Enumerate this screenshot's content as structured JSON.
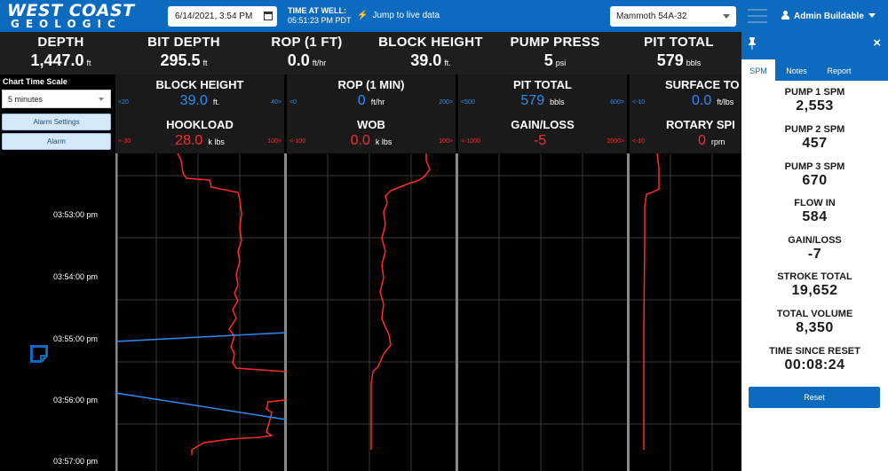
{
  "header": {
    "logo_line1": "WEST COAST",
    "logo_line2": "GEOLOGIC",
    "datetime_value": "6/14/2021, 3:54 PM",
    "time_at_well_label": "TIME AT WELL:",
    "time_at_well_value": "05:51:23 PM PDT",
    "jump_label": "Jump to live data",
    "well_selected": "Mammoth 54A-32",
    "user_label": "Admin Buildable"
  },
  "metrics": [
    {
      "label": "DEPTH",
      "value": "1,447.0",
      "unit": "ft"
    },
    {
      "label": "BIT DEPTH",
      "value": "295.5",
      "unit": "ft"
    },
    {
      "label": "ROP (1 FT)",
      "value": "0.0",
      "unit": "ft/hr"
    },
    {
      "label": "BLOCK HEIGHT",
      "value": "39.0",
      "unit": "ft."
    },
    {
      "label": "PUMP PRESS",
      "value": "5",
      "unit": "psi"
    },
    {
      "label": "PIT TOTAL",
      "value": "579",
      "unit": "bbls"
    }
  ],
  "left": {
    "time_scale_label": "Chart Time Scale",
    "time_scale_value": "5 minutes",
    "alarm_settings_label": "Alarm Settings",
    "alarm_label": "Alarm",
    "times": [
      "03:53:00 pm",
      "03:54:00 pm",
      "03:55:00 pm",
      "03:56:00 pm",
      "03:57:00 pm"
    ]
  },
  "tracks": [
    {
      "top": {
        "label": "BLOCK HEIGHT",
        "value": "39.0",
        "unit": "ft.",
        "min": "<20",
        "max": "40>",
        "color": "#2d8cf0"
      },
      "bottom": {
        "label": "HOOKLOAD",
        "value": "28.0",
        "unit": "k lbs",
        "min": "<-30",
        "max": "100>",
        "color": "#ff2a2a"
      }
    },
    {
      "top": {
        "label": "ROP (1 MIN)",
        "value": "0",
        "unit": "ft/hr",
        "min": "<0",
        "max": "200>",
        "color": "#2d8cf0"
      },
      "bottom": {
        "label": "WOB",
        "value": "0.0",
        "unit": "k lbs",
        "min": "<-100",
        "max": "100>",
        "color": "#ff2a2a"
      }
    },
    {
      "top": {
        "label": "PIT TOTAL",
        "value": "579",
        "unit": "bbls",
        "min": "<500",
        "max": "600>",
        "color": "#2d8cf0"
      },
      "bottom": {
        "label": "GAIN/LOSS",
        "value": "-5",
        "unit": "",
        "min": "<-1000",
        "max": "2000>",
        "color": "#ff2a2a"
      }
    },
    {
      "top": {
        "label": "SURFACE TO",
        "value": "0.0",
        "unit": "ft/lbs",
        "min": "<-10",
        "max": "",
        "color": "#2d8cf0"
      },
      "bottom": {
        "label": "ROTARY SPI",
        "value": "0",
        "unit": "rpm",
        "min": "<-10",
        "max": "",
        "color": "#ff2a2a"
      }
    }
  ],
  "side": {
    "tabs": [
      "SPM",
      "Notes",
      "Report"
    ],
    "items": [
      {
        "label": "PUMP 1 SPM",
        "value": "2,553"
      },
      {
        "label": "PUMP 2 SPM",
        "value": "457"
      },
      {
        "label": "PUMP 3 SPM",
        "value": "670"
      },
      {
        "label": "FLOW IN",
        "value": "584"
      },
      {
        "label": "GAIN/LOSS",
        "value": "-7"
      },
      {
        "label": "STROKE TOTAL",
        "value": "19,652"
      },
      {
        "label": "TOTAL VOLUME",
        "value": "8,350"
      },
      {
        "label": "TIME SINCE RESET",
        "value": "00:08:24"
      }
    ],
    "reset_label": "Reset"
  },
  "colors": {
    "brand": "#0d6bbf",
    "curve_red": "#ff2a2a",
    "curve_blue": "#2d8cf0"
  }
}
